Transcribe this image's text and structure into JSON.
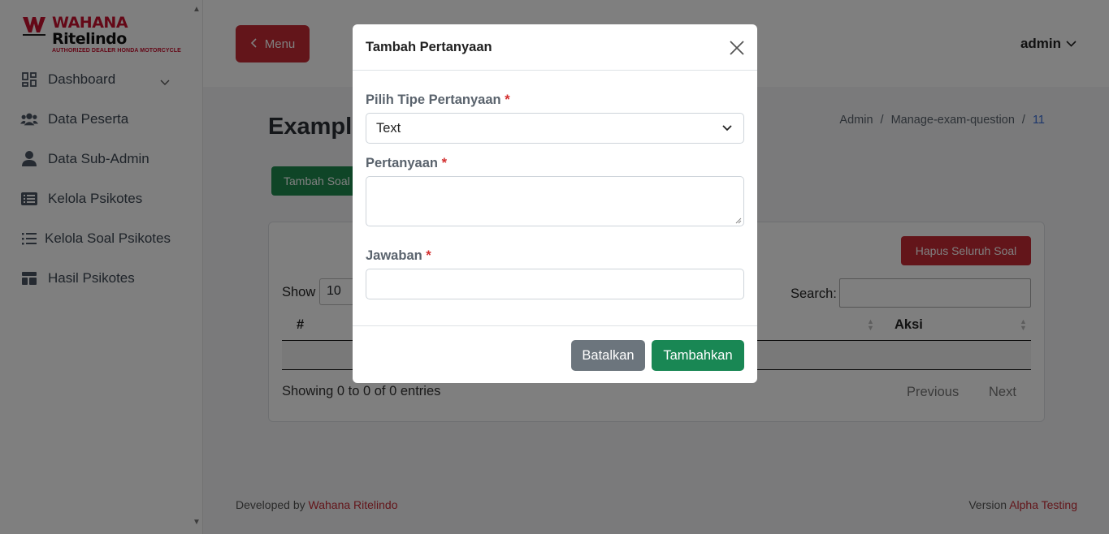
{
  "brand": {
    "name_part1": "WAHANA",
    "name_part2": "Ritelindo",
    "tagline": "AUTHORIZED DEALER HONDA MOTORCYCLE",
    "accent_color": "#c8102e"
  },
  "sidebar": {
    "items": [
      {
        "label": "Dashboard",
        "icon": "dashboard-grid-icon"
      },
      {
        "label": "Data Peserta",
        "icon": "users-icon"
      },
      {
        "label": "Data Sub-Admin",
        "icon": "user-icon"
      },
      {
        "label": "Kelola Psikotes",
        "icon": "list-box-icon"
      },
      {
        "label": "Kelola Soal Psikotes",
        "icon": "list-icon"
      },
      {
        "label": "Hasil Psikotes",
        "icon": "layout-icon"
      }
    ]
  },
  "header": {
    "menu_label": "Menu",
    "user_label": "admin"
  },
  "main": {
    "title": "Example",
    "breadcrumb": [
      "Admin",
      "Manage-exam-question",
      "11"
    ],
    "add_button": "Tambah Soal",
    "delete_all_button": "Hapus Seluruh Soal",
    "show_label": "Show",
    "show_value": "10",
    "search_label": "Search:",
    "columns": [
      "#",
      "Aksi"
    ],
    "info": "Showing 0 to 0 of 0 entries",
    "prev_label": "Previous",
    "next_label": "Next"
  },
  "footer": {
    "dev_prefix": "Developed by",
    "dev_name": "Wahana Ritelindo",
    "version_prefix": "Version",
    "version_name": "Alpha Testing"
  },
  "modal": {
    "title": "Tambah Pertanyaan",
    "type_label": "Pilih Tipe Pertanyaan",
    "type_value": "Text",
    "question_label": "Pertanyaan",
    "answer_label": "Jawaban",
    "required_mark": "*",
    "cancel_label": "Batalkan",
    "submit_label": "Tambahkan"
  }
}
